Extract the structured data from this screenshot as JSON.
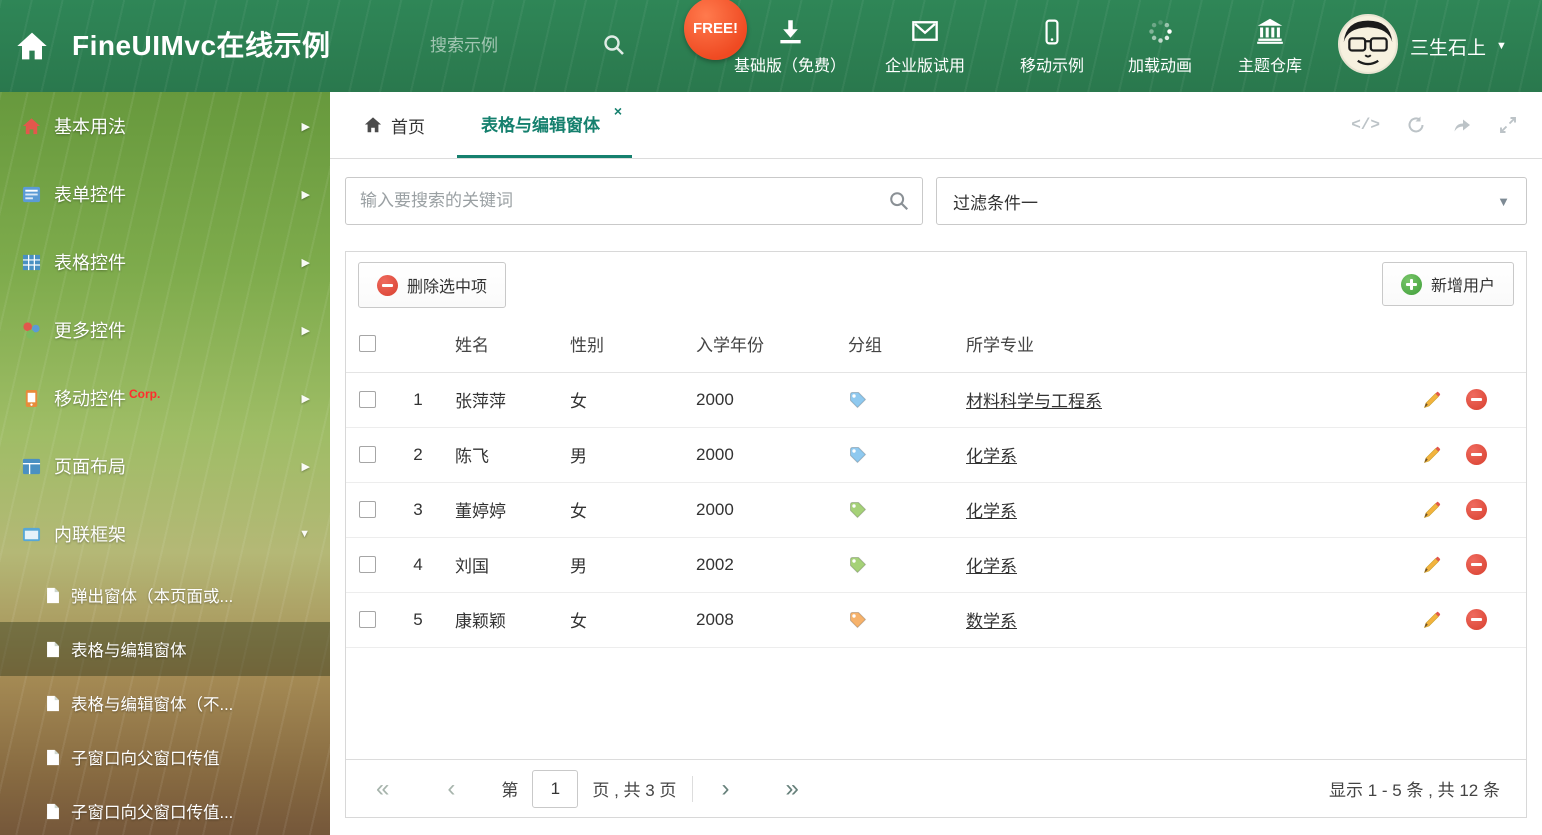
{
  "header": {
    "title": "FineUIMvc在线示例",
    "search_placeholder": "搜索示例",
    "free_badge": "FREE!",
    "nav": [
      {
        "label": "基础版（免费）",
        "icon": "download-icon"
      },
      {
        "label": "企业版试用",
        "icon": "envelope-icon"
      },
      {
        "label": "移动示例",
        "icon": "mobile-icon"
      },
      {
        "label": "加载动画",
        "icon": "spinner-icon"
      },
      {
        "label": "主题仓库",
        "icon": "bank-icon"
      }
    ],
    "user": "三生石上"
  },
  "sidebar": {
    "menu": [
      {
        "label": "基本用法",
        "icon": "home-icon"
      },
      {
        "label": "表单控件",
        "icon": "form-icon"
      },
      {
        "label": "表格控件",
        "icon": "table-icon"
      },
      {
        "label": "更多控件",
        "icon": "widgets-icon"
      },
      {
        "label": "移动控件",
        "badge": "Corp.",
        "icon": "mobile-icon"
      },
      {
        "label": "页面布局",
        "icon": "layout-icon"
      },
      {
        "label": "内联框架",
        "icon": "frame-icon"
      }
    ],
    "submenu": [
      {
        "label": "弹出窗体（本页面或..."
      },
      {
        "label": "表格与编辑窗体",
        "selected": true
      },
      {
        "label": "表格与编辑窗体（不..."
      },
      {
        "label": "子窗口向父窗口传值"
      },
      {
        "label": "子窗口向父窗口传值..."
      }
    ]
  },
  "tabs": {
    "home": "首页",
    "active": "表格与编辑窗体"
  },
  "search": {
    "placeholder": "输入要搜索的关键词"
  },
  "filter": {
    "value": "过滤条件一"
  },
  "toolbar": {
    "delete_selected": "删除选中项",
    "add_user": "新增用户"
  },
  "table": {
    "columns": {
      "name": "姓名",
      "gender": "性别",
      "year": "入学年份",
      "group": "分组",
      "major": "所学专业"
    },
    "rows": [
      {
        "num": "1",
        "name": "张萍萍",
        "gender": "女",
        "year": "2000",
        "tag_color": "#8fc9ef",
        "major": "材料科学与工程系"
      },
      {
        "num": "2",
        "name": "陈飞",
        "gender": "男",
        "year": "2000",
        "tag_color": "#8fc9ef",
        "major": "化学系"
      },
      {
        "num": "3",
        "name": "董婷婷",
        "gender": "女",
        "year": "2000",
        "tag_color": "#a5d178",
        "major": "化学系"
      },
      {
        "num": "4",
        "name": "刘国",
        "gender": "男",
        "year": "2002",
        "tag_color": "#a5d178",
        "major": "化学系"
      },
      {
        "num": "5",
        "name": "康颖颖",
        "gender": "女",
        "year": "2008",
        "tag_color": "#f6b26b",
        "major": "数学系"
      }
    ]
  },
  "pagination": {
    "prefix": "第",
    "page": "1",
    "suffix": "页 , 共 3 页",
    "summary": "显示 1 - 5 条 , 共 12 条"
  },
  "colors": {
    "accent_teal": "#15806e",
    "header_green": "#2c8054",
    "delete_red": "#d8402f",
    "add_green": "#3f9e3a",
    "free_badge_red": "#ef4a22",
    "corp_red": "#ff2d2d"
  }
}
